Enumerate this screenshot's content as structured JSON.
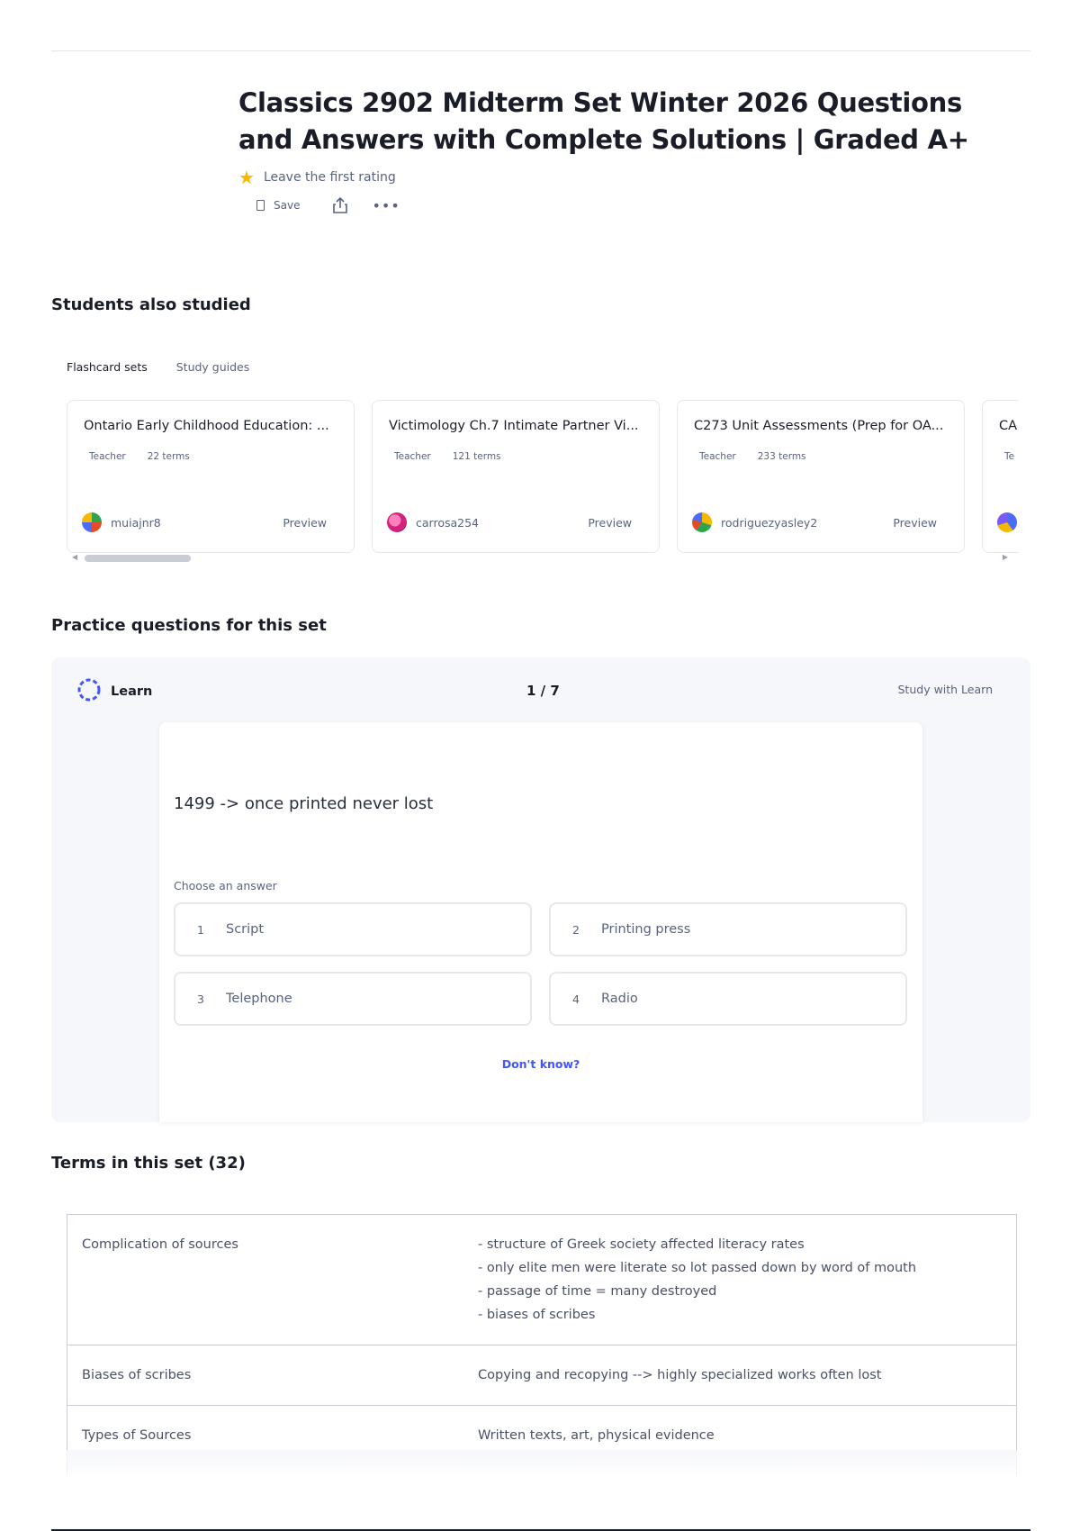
{
  "header": {
    "title": "Classics 2902 Midterm Set Winter 2026 Questions and Answers with Complete Solutions | Graded A+",
    "rating_text": "Leave the first rating",
    "save_label": "Save"
  },
  "students_section": {
    "title": "Students also studied",
    "tabs": [
      "Flashcard sets",
      "Study guides"
    ],
    "cards": [
      {
        "title": "Ontario Early Childhood Education: ...",
        "role": "Teacher",
        "terms": "22 terms",
        "user": "muiajnr8",
        "preview": "Preview"
      },
      {
        "title": "Victimology Ch.7 Intimate Partner Vi...",
        "role": "Teacher",
        "terms": "121 terms",
        "user": "carrosa254",
        "preview": "Preview"
      },
      {
        "title": "C273 Unit Assessments (Prep for OA...",
        "role": "Teacher",
        "terms": "233 terms",
        "user": "rodriguezyasley2",
        "preview": "Preview"
      },
      {
        "title": "CA",
        "role": "Te",
        "terms": "",
        "user": "",
        "preview": ""
      }
    ]
  },
  "practice_section": {
    "title": "Practice questions for this set",
    "learn_label": "Learn",
    "progress": "1 / 7",
    "study_with_learn": "Study with Learn",
    "question": "1499 -> once printed never lost",
    "choose_label": "Choose an answer",
    "answers": [
      {
        "num": "1",
        "text": "Script"
      },
      {
        "num": "2",
        "text": "Printing press"
      },
      {
        "num": "3",
        "text": "Telephone"
      },
      {
        "num": "4",
        "text": "Radio"
      }
    ],
    "dont_know": "Don't know?"
  },
  "terms_section": {
    "title": "Terms in this set (32)",
    "rows": [
      {
        "term": "Complication of sources",
        "definition": [
          "- structure of Greek society affected literacy rates",
          "- only elite men were literate so lot passed down by word of mouth",
          "- passage of time = many destroyed",
          "- biases of scribes"
        ]
      },
      {
        "term": "Biases of scribes",
        "definition": [
          "Copying and recopying --> highly specialized works often lost"
        ]
      },
      {
        "term": "Types of Sources",
        "definition": [
          "Written texts, art, physical evidence"
        ]
      }
    ]
  },
  "colors": {
    "accent": "#4255ff",
    "star": "#f5b700",
    "text_primary": "#1a1d28",
    "text_secondary": "#586380"
  }
}
